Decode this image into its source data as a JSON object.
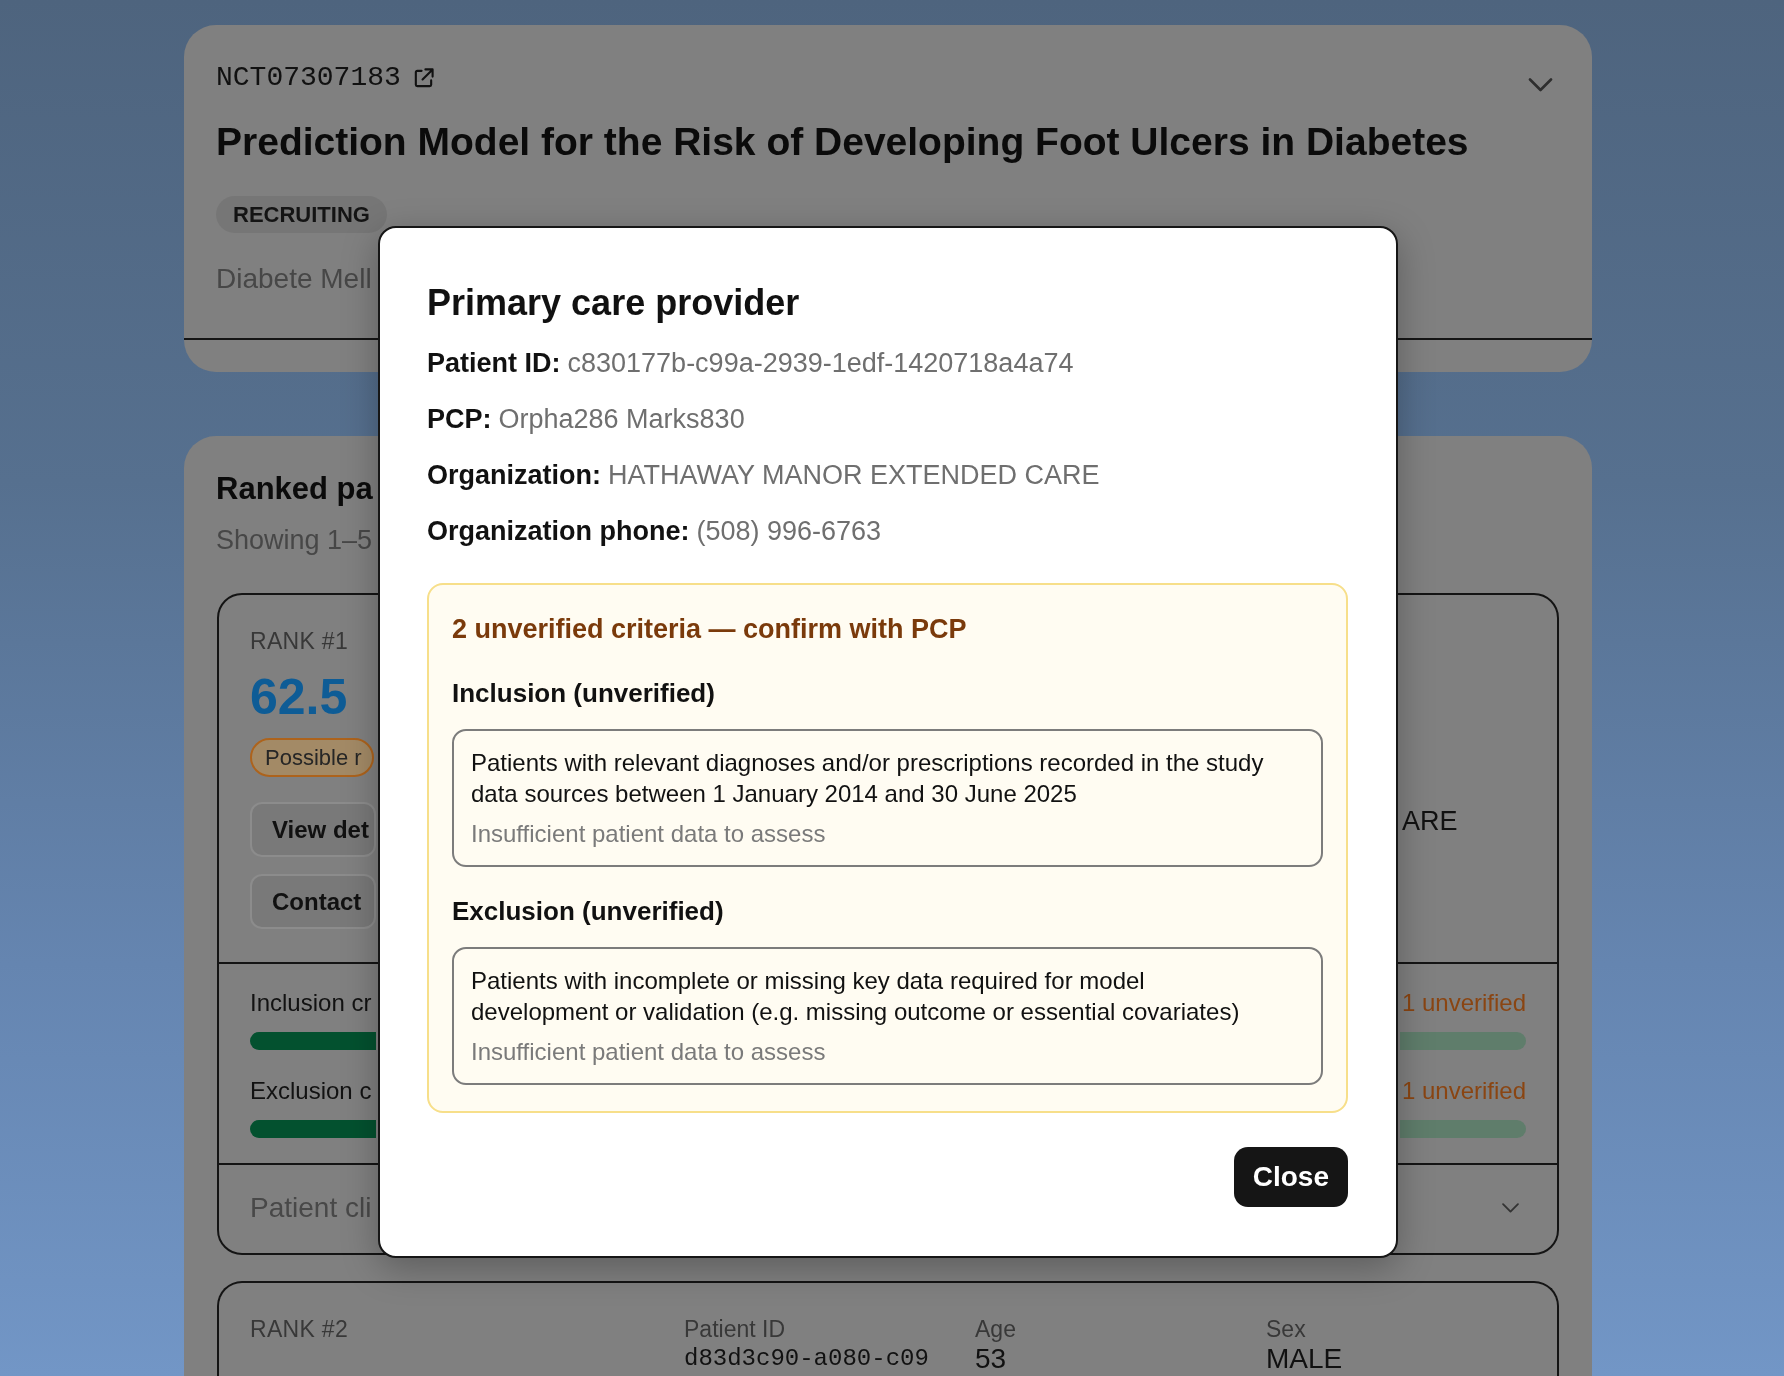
{
  "trial": {
    "id": "NCT07307183",
    "title": "Prediction Model for the Risk of Developing Foot Ulcers in Diabetes",
    "status": "RECRUITING",
    "conditions": "Diabete Mell"
  },
  "patients_panel": {
    "title": "Ranked pa",
    "subtitle": "Showing 1–5",
    "patients": [
      {
        "rank": "RANK #1",
        "score": "62.5",
        "badge": "Possible r",
        "actions": [
          "View det",
          "Contact"
        ],
        "organization": "ARE",
        "criteria": [
          {
            "label": "Inclusion cr",
            "status": "1 unverified"
          },
          {
            "label": "Exclusion c",
            "status": "1 unverified"
          }
        ],
        "section_toggle": "Patient cli"
      },
      {
        "rank": "RANK #2",
        "fields": [
          {
            "label": "Patient ID",
            "value": "d83d3c90-a080-c09",
            "kind": "mono"
          },
          {
            "label": "Age",
            "value": "53",
            "kind": "text"
          },
          {
            "label": "Sex",
            "value": "MALE",
            "kind": "text"
          }
        ]
      }
    ]
  },
  "modal": {
    "title": "Primary care provider",
    "fields": [
      {
        "label": "Patient ID:",
        "value": "c830177b-c99a-2939-1edf-1420718a4a74"
      },
      {
        "label": "PCP:",
        "value": "Orpha286 Marks830"
      },
      {
        "label": "Organization:",
        "value": "HATHAWAY MANOR EXTENDED CARE"
      },
      {
        "label": "Organization phone:",
        "value": "(508) 996-6763"
      }
    ],
    "warning": {
      "title": "2 unverified criteria — confirm with PCP",
      "groups": [
        {
          "heading": "Inclusion (unverified)",
          "criteria": [
            {
              "text": "Patients with relevant diagnoses and/or prescriptions recorded in the study data sources between 1 January 2014 and 30 June 2025",
              "note": "Insufficient patient data to assess"
            }
          ]
        },
        {
          "heading": "Exclusion (unverified)",
          "criteria": [
            {
              "text": "Patients with incomplete or missing key data required for model development or validation (e.g. missing outcome or essential covariates)",
              "note": "Insufficient patient data to assess"
            }
          ]
        }
      ]
    },
    "close_button": "Close"
  }
}
